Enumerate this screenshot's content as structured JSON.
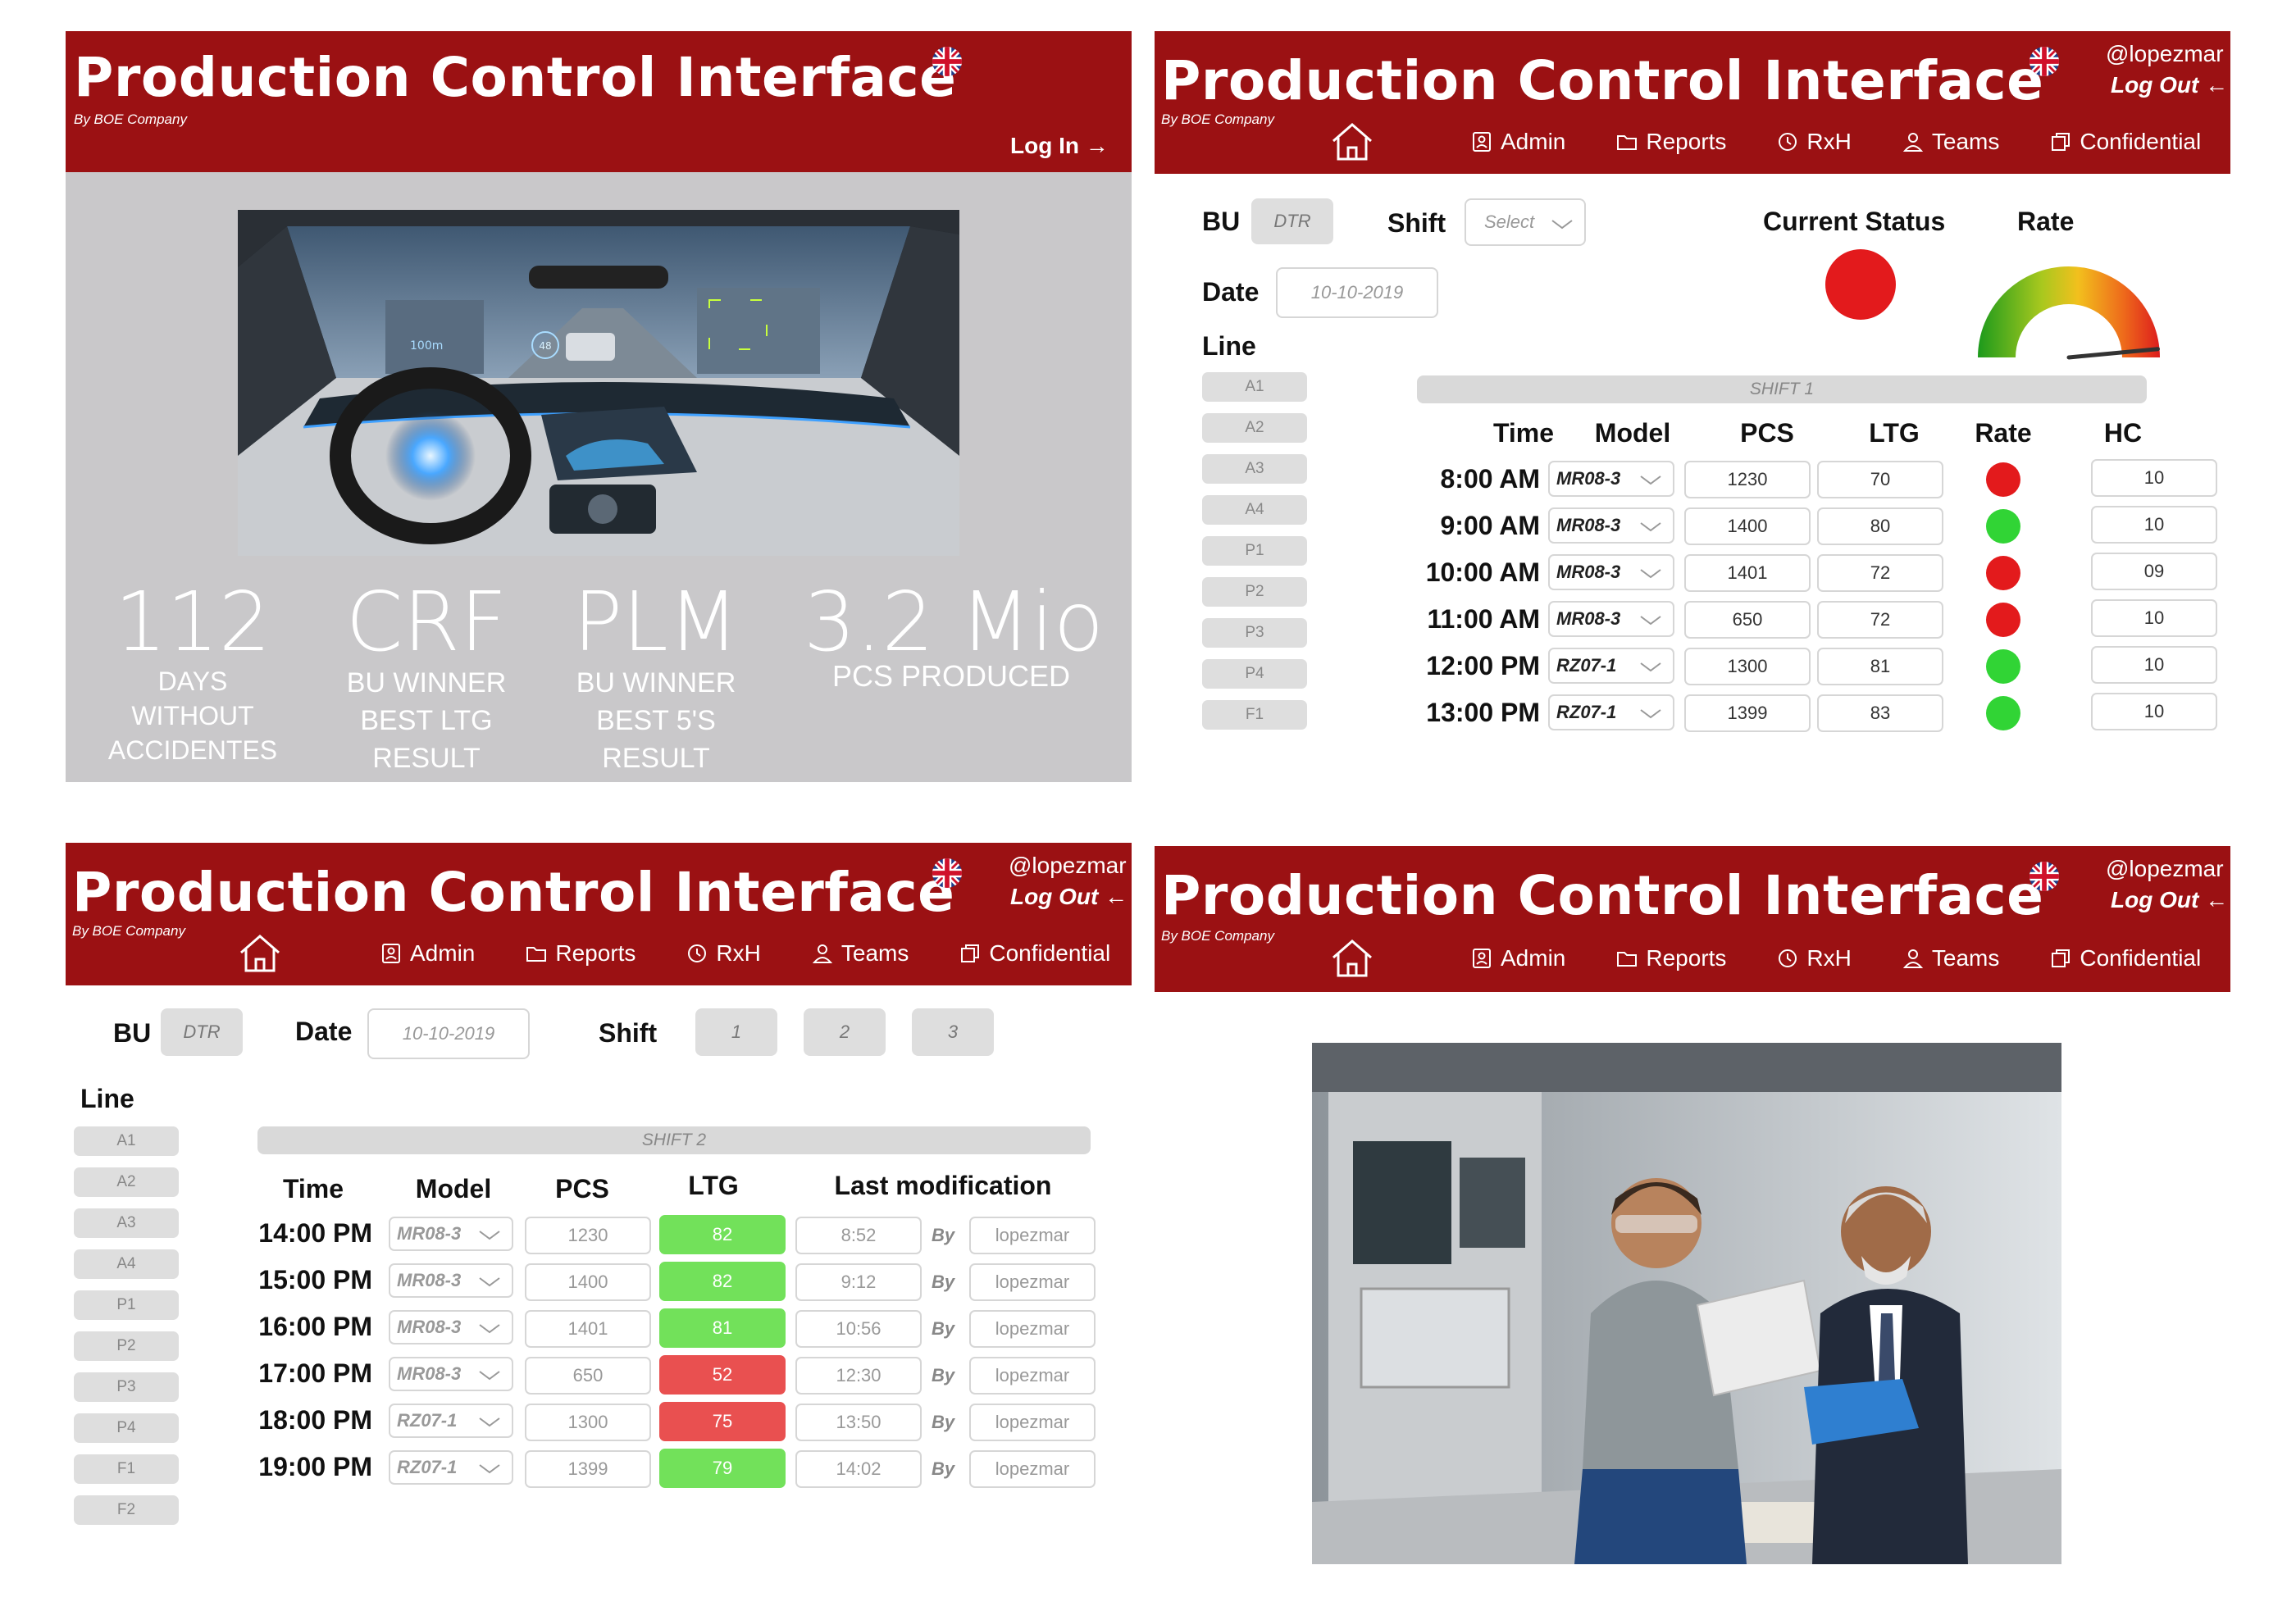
{
  "app": {
    "title": "Production Control Interface",
    "subtitle": "By BOE Company",
    "user": "@lopezmar",
    "login_label": "Log In",
    "logout_label": "Log Out",
    "nav": [
      "Admin",
      "Reports",
      "RxH",
      "Teams",
      "Confidential"
    ],
    "colors": {
      "brand": "#9b1113",
      "red": "#e31a1c",
      "green": "#31d435",
      "ltg_green": "#72e15a",
      "ltg_red": "#e95050"
    }
  },
  "landing": {
    "stats": [
      {
        "big": "112",
        "small": [
          "DAYS",
          "WITHOUT",
          "ACCIDENTES"
        ]
      },
      {
        "big": "CRF",
        "small": [
          "BU WINNER",
          "BEST LTG",
          "RESULT"
        ]
      },
      {
        "big": "PLM",
        "small": [
          "BU WINNER",
          "BEST 5'S",
          "RESULT"
        ]
      },
      {
        "big": "3.2 Mio",
        "small": [
          "PCS PRODUCED"
        ]
      }
    ],
    "hud": {
      "distance": "100m",
      "speed": "48"
    }
  },
  "dashboard1": {
    "bu_label": "BU",
    "bu_value": "DTR",
    "shift_label": "Shift",
    "shift_placeholder": "Select",
    "date_label": "Date",
    "date_value": "10-10-2019",
    "line_label": "Line",
    "lines": [
      "A1",
      "A2",
      "A3",
      "A4",
      "P1",
      "P2",
      "P3",
      "P4",
      "F1"
    ],
    "current_status_label": "Current Status",
    "current_status": "red",
    "rate_label": "Rate",
    "gauge_needle_fraction": 0.97,
    "shift_bar": "SHIFT 1",
    "columns": [
      "Time",
      "Model",
      "PCS",
      "LTG",
      "Rate",
      "HC"
    ],
    "rows": [
      {
        "time": "8:00 AM",
        "model": "MR08-3",
        "pcs": "1230",
        "ltg": "70",
        "rate": "red",
        "hc": "10"
      },
      {
        "time": "9:00 AM",
        "model": "MR08-3",
        "pcs": "1400",
        "ltg": "80",
        "rate": "green",
        "hc": "10"
      },
      {
        "time": "10:00 AM",
        "model": "MR08-3",
        "pcs": "1401",
        "ltg": "72",
        "rate": "red",
        "hc": "09"
      },
      {
        "time": "11:00 AM",
        "model": "MR08-3",
        "pcs": "650",
        "ltg": "72",
        "rate": "red",
        "hc": "10"
      },
      {
        "time": "12:00 PM",
        "model": "RZ07-1",
        "pcs": "1300",
        "ltg": "81",
        "rate": "green",
        "hc": "10"
      },
      {
        "time": "13:00 PM",
        "model": "RZ07-1",
        "pcs": "1399",
        "ltg": "83",
        "rate": "green",
        "hc": "10"
      }
    ]
  },
  "dashboard2": {
    "bu_label": "BU",
    "bu_value": "DTR",
    "date_label": "Date",
    "date_value": "10-10-2019",
    "shift_label": "Shift",
    "shift_options": [
      "1",
      "2",
      "3"
    ],
    "line_label": "Line",
    "lines": [
      "A1",
      "A2",
      "A3",
      "A4",
      "P1",
      "P2",
      "P3",
      "P4",
      "F1",
      "F2"
    ],
    "shift_bar": "SHIFT 2",
    "columns": [
      "Time",
      "Model",
      "PCS",
      "LTG",
      "Last modification"
    ],
    "by_label": "By",
    "rows": [
      {
        "time": "14:00 PM",
        "model": "MR08-3",
        "pcs": "1230",
        "ltg": "82",
        "ltg_status": "green",
        "mod": "8:52",
        "user": "lopezmar"
      },
      {
        "time": "15:00 PM",
        "model": "MR08-3",
        "pcs": "1400",
        "ltg": "82",
        "ltg_status": "green",
        "mod": "9:12",
        "user": "lopezmar"
      },
      {
        "time": "16:00 PM",
        "model": "MR08-3",
        "pcs": "1401",
        "ltg": "81",
        "ltg_status": "green",
        "mod": "10:56",
        "user": "lopezmar"
      },
      {
        "time": "17:00 PM",
        "model": "MR08-3",
        "pcs": "650",
        "ltg": "52",
        "ltg_status": "red",
        "mod": "12:30",
        "user": "lopezmar"
      },
      {
        "time": "18:00 PM",
        "model": "RZ07-1",
        "pcs": "1300",
        "ltg": "75",
        "ltg_status": "red",
        "mod": "13:50",
        "user": "lopezmar"
      },
      {
        "time": "19:00 PM",
        "model": "RZ07-1",
        "pcs": "1399",
        "ltg": "79",
        "ltg_status": "green",
        "mod": "14:02",
        "user": "lopezmar"
      }
    ]
  }
}
